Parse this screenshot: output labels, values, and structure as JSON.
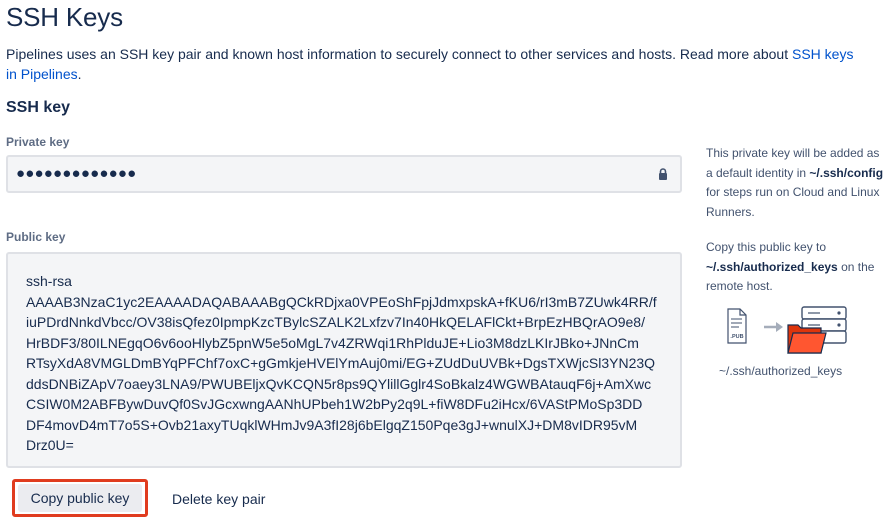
{
  "page": {
    "title": "SSH Keys",
    "intro_text": "Pipelines uses an SSH key pair and known host information to securely connect to other services and hosts. Read more about ",
    "intro_link": "SSH keys in Pipelines",
    "intro_end": "."
  },
  "ssh_key": {
    "heading": "SSH key",
    "private_label": "Private key",
    "private_value": "●●●●●●●●●●●●●",
    "public_label": "Public key",
    "public_lines": [
      "ssh-rsa",
      "AAAAB3NzaC1yc2EAAAADAQABAAABgQCkRDjxa0VPEoShFpjJdmxpskA+fKU6/rI3mB7ZUwk4RR/f",
      "iuPDrdNnkdVbcc/OV38isQfez0IpmpKzcTBylcSZALK2Lxfzv7In40HkQELAFlCkt+BrpEzHBQrAO9e8/",
      "HrBDF3/80ILNEgqO6v6ooHlybZ5pnW5e5oMgL7v4ZRWqi1RhPlduJE+Lio3M8dzLKIrJBko+JNnCm",
      "RTsyXdA8VMGLDmBYqPFChf7oxC+gGmkjeHVElYmAuj0mi/EG+ZUdDuUVBk+DgsTXWjcSl3YN23Q",
      "ddsDNBiZApV7oaey3LNA9/PWUBEljxQvKCQN5r8ps9QYlillGglr4SoBkalz4WGWBAtauqF6j+AmXwc",
      "CSIW0M2ABFBywDuvQf0SvJGcxwngAANhUPbeh1W2bPy2q9L+fiW8DFu2iHcx/6VAStPMoSp3DD",
      "DF4movD4mT7o5S+Ovb21axyTUqklWHmJv9A3fI28j6bElgqZ150Pqe3gJ+wnulXJ+DM8vIDR95vM",
      "Drz0U="
    ]
  },
  "help": {
    "private": {
      "pre": "This private key will be added as a default identity in ",
      "bold": "~/.ssh/config",
      "post": " for steps run on Cloud and Linux Runners."
    },
    "public": {
      "pre": "Copy this public key to ",
      "bold": "~/.ssh/authorized_keys",
      "post": " on the remote host."
    },
    "diagram": {
      "file_label": ".PUB",
      "caption": "~/.ssh/authorized_keys"
    }
  },
  "actions": {
    "copy_label": "Copy public key",
    "delete_label": "Delete key pair"
  },
  "colors": {
    "link": "#0052cc",
    "highlight_border": "#e03c1f",
    "folder": "#de350b",
    "server": "#42526e"
  }
}
